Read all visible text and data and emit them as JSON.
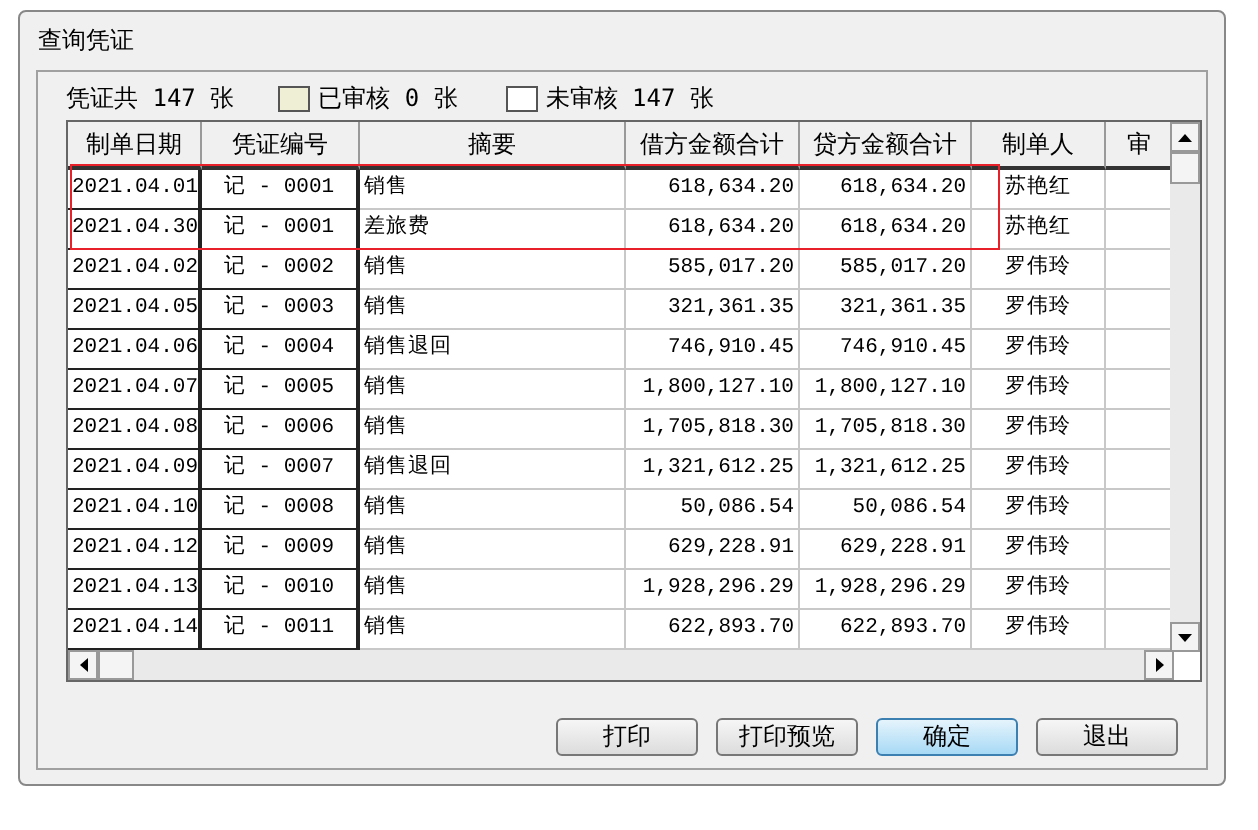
{
  "window": {
    "title": "查询凭证"
  },
  "summary": {
    "total": "凭证共 147 张",
    "approved": "已审核 0 张",
    "pending": "未审核 147 张"
  },
  "table": {
    "columns": [
      "制单日期",
      "凭证编号",
      "摘要",
      "借方金额合计",
      "贷方金额合计",
      "制单人",
      "审"
    ],
    "rows": [
      {
        "date": "2021.04.01",
        "number": "记 - 0001",
        "summary": "销售",
        "debit": "618,634.20",
        "credit": "618,634.20",
        "maker": "苏艳红",
        "annotated": true
      },
      {
        "date": "2021.04.30",
        "number": "记 - 0001",
        "summary": "差旅费",
        "debit": "618,634.20",
        "credit": "618,634.20",
        "maker": "苏艳红",
        "annotated": true
      },
      {
        "date": "2021.04.02",
        "number": "记 - 0002",
        "summary": "销售",
        "debit": "585,017.20",
        "credit": "585,017.20",
        "maker": "罗伟玲",
        "annotated": false
      },
      {
        "date": "2021.04.05",
        "number": "记 - 0003",
        "summary": "销售",
        "debit": "321,361.35",
        "credit": "321,361.35",
        "maker": "罗伟玲",
        "annotated": false
      },
      {
        "date": "2021.04.06",
        "number": "记 - 0004",
        "summary": "销售退回",
        "debit": "746,910.45",
        "credit": "746,910.45",
        "maker": "罗伟玲",
        "annotated": false
      },
      {
        "date": "2021.04.07",
        "number": "记 - 0005",
        "summary": "销售",
        "debit": "1,800,127.10",
        "credit": "1,800,127.10",
        "maker": "罗伟玲",
        "annotated": false
      },
      {
        "date": "2021.04.08",
        "number": "记 - 0006",
        "summary": "销售",
        "debit": "1,705,818.30",
        "credit": "1,705,818.30",
        "maker": "罗伟玲",
        "annotated": false
      },
      {
        "date": "2021.04.09",
        "number": "记 - 0007",
        "summary": "销售退回",
        "debit": "1,321,612.25",
        "credit": "1,321,612.25",
        "maker": "罗伟玲",
        "annotated": false
      },
      {
        "date": "2021.04.10",
        "number": "记 - 0008",
        "summary": "销售",
        "debit": "50,086.54",
        "credit": "50,086.54",
        "maker": "罗伟玲",
        "annotated": false
      },
      {
        "date": "2021.04.12",
        "number": "记 - 0009",
        "summary": "销售",
        "debit": "629,228.91",
        "credit": "629,228.91",
        "maker": "罗伟玲",
        "annotated": false
      },
      {
        "date": "2021.04.13",
        "number": "记 - 0010",
        "summary": "销售",
        "debit": "1,928,296.29",
        "credit": "1,928,296.29",
        "maker": "罗伟玲",
        "annotated": false
      },
      {
        "date": "2021.04.14",
        "number": "记 - 0011",
        "summary": "销售",
        "debit": "622,893.70",
        "credit": "622,893.70",
        "maker": "罗伟玲",
        "annotated": false
      }
    ]
  },
  "buttons": [
    {
      "label": "打印",
      "default": false
    },
    {
      "label": "打印预览",
      "default": false
    },
    {
      "label": "确定",
      "default": true
    },
    {
      "label": "退出",
      "default": false
    }
  ]
}
